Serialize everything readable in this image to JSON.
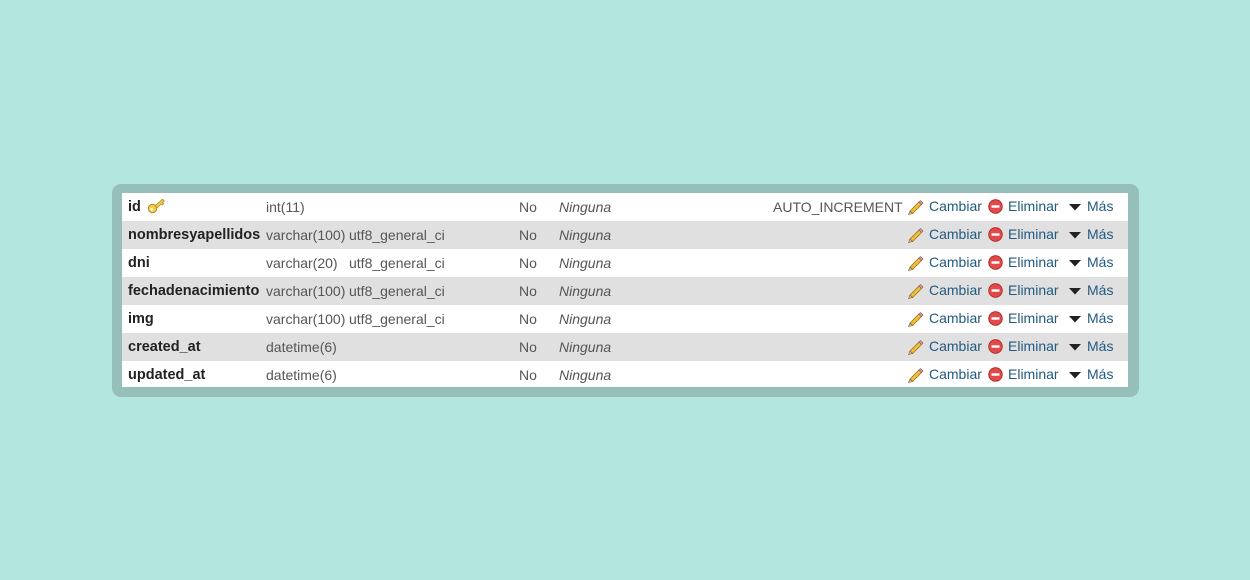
{
  "colors": {
    "background": "#b3e6de",
    "panel": "#97bfba",
    "row_alt": "#e0e0e0",
    "link": "#235a81",
    "delete_icon": "#e04a4a",
    "edit_icon": "#e8b93a"
  },
  "icons": {
    "primary_key": "key-icon",
    "change": "pencil-icon",
    "delete": "delete-icon",
    "more": "triangle-down-icon"
  },
  "actions": {
    "change_label": "Cambiar",
    "delete_label": "Eliminar",
    "more_label": "Más"
  },
  "columns": [
    {
      "name": "id",
      "type": "int(11)",
      "collation": "",
      "null": "No",
      "default": "Ninguna",
      "extra": "AUTO_INCREMENT",
      "primary_key": true
    },
    {
      "name": "nombresyapellidos",
      "type": "varchar(100)",
      "collation": "utf8_general_ci",
      "null": "No",
      "default": "Ninguna",
      "extra": "",
      "primary_key": false
    },
    {
      "name": "dni",
      "type": "varchar(20)",
      "collation": "utf8_general_ci",
      "null": "No",
      "default": "Ninguna",
      "extra": "",
      "primary_key": false
    },
    {
      "name": "fechadenacimiento",
      "type": "varchar(100)",
      "collation": "utf8_general_ci",
      "null": "No",
      "default": "Ninguna",
      "extra": "",
      "primary_key": false
    },
    {
      "name": "img",
      "type": "varchar(100)",
      "collation": "utf8_general_ci",
      "null": "No",
      "default": "Ninguna",
      "extra": "",
      "primary_key": false
    },
    {
      "name": "created_at",
      "type": "datetime(6)",
      "collation": "",
      "null": "No",
      "default": "Ninguna",
      "extra": "",
      "primary_key": false
    },
    {
      "name": "updated_at",
      "type": "datetime(6)",
      "collation": "",
      "null": "No",
      "default": "Ninguna",
      "extra": "",
      "primary_key": false
    }
  ]
}
